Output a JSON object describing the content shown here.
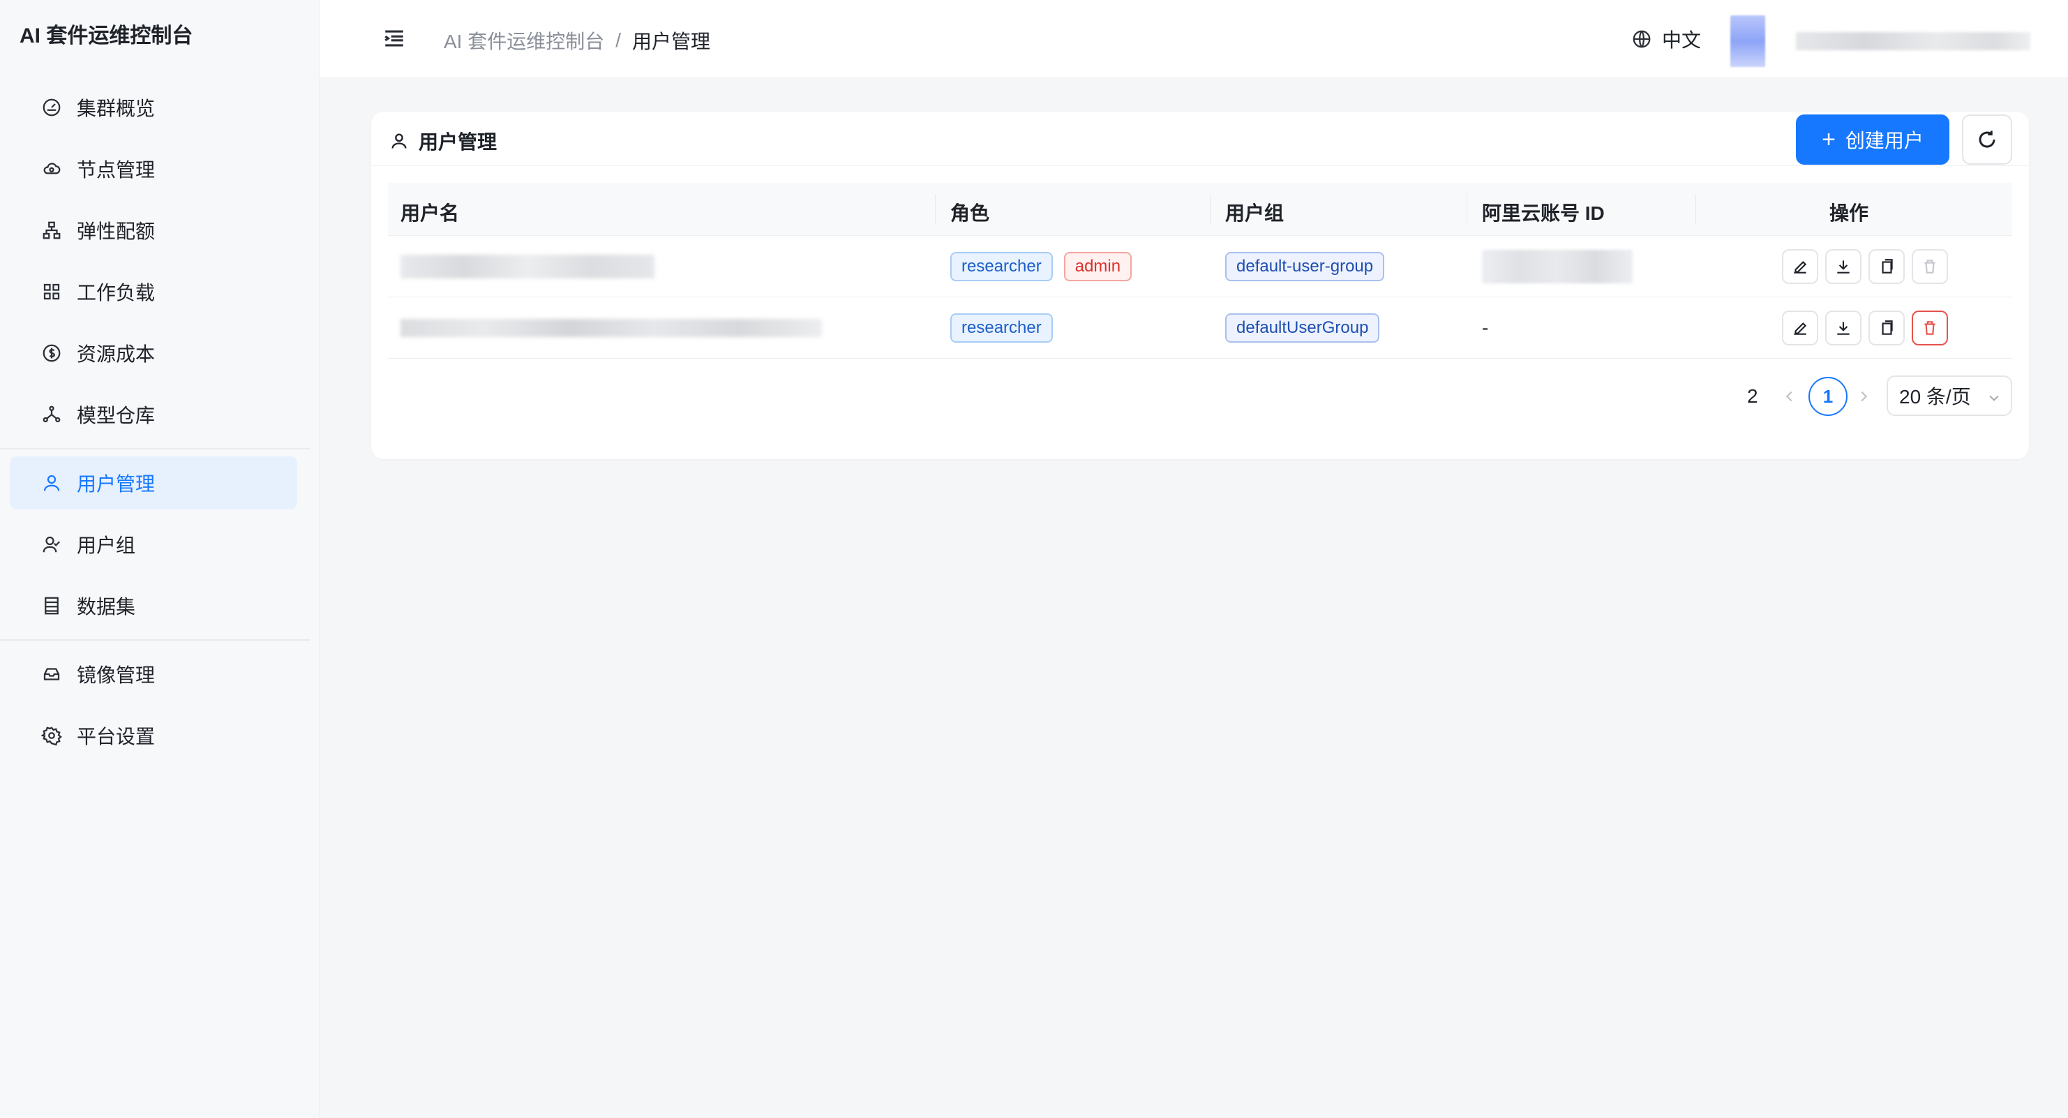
{
  "app": {
    "title": "AI 套件运维控制台"
  },
  "sidebar": {
    "items": [
      {
        "label": "集群概览",
        "icon": "gauge-icon"
      },
      {
        "label": "节点管理",
        "icon": "cloud-icon"
      },
      {
        "label": "弹性配额",
        "icon": "hierarchy-icon"
      },
      {
        "label": "工作负载",
        "icon": "grid-icon"
      },
      {
        "label": "资源成本",
        "icon": "dollar-icon"
      },
      {
        "label": "模型仓库",
        "icon": "model-nodes-icon"
      },
      {
        "label": "用户管理",
        "icon": "user-icon",
        "active": true
      },
      {
        "label": "用户组",
        "icon": "users-icon"
      },
      {
        "label": "数据集",
        "icon": "dataset-icon"
      },
      {
        "label": "镜像管理",
        "icon": "box-icon"
      },
      {
        "label": "平台设置",
        "icon": "gear-icon"
      }
    ]
  },
  "header": {
    "breadcrumb": {
      "parent": "AI 套件运维控制台",
      "separator": "/",
      "current": "用户管理"
    },
    "language": "中文"
  },
  "card": {
    "title": "用户管理",
    "create_label": "创建用户"
  },
  "table": {
    "columns": [
      "用户名",
      "角色",
      "用户组",
      "阿里云账号 ID",
      "操作"
    ],
    "rows": [
      {
        "roles": [
          "researcher",
          "admin"
        ],
        "group": "default-user-group",
        "account": ""
      },
      {
        "roles": [
          "researcher"
        ],
        "group": "defaultUserGroup",
        "account": "-"
      }
    ]
  },
  "pagination": {
    "total": "2",
    "current_page": "1",
    "page_size": "20 条/页"
  },
  "colors": {
    "accent": "#1677ff",
    "danger": "#e5534b",
    "active_bg": "#e6f1fd"
  }
}
